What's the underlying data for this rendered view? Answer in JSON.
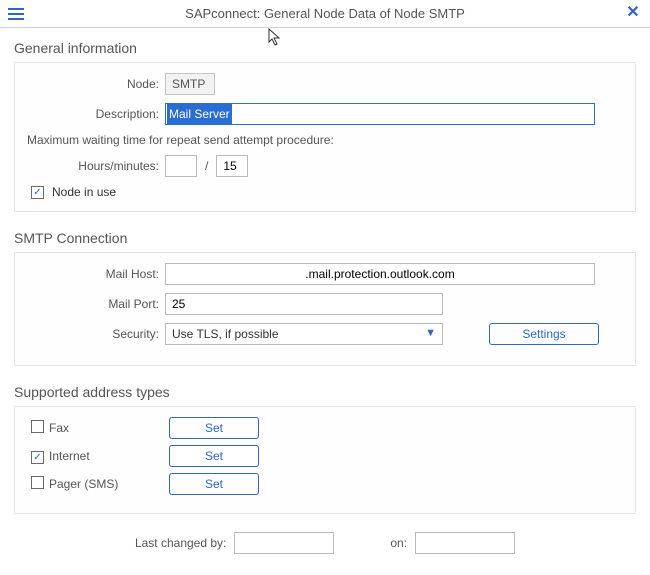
{
  "header": {
    "title": "SAPconnect: General Node Data of Node SMTP"
  },
  "general": {
    "title": "General information",
    "node_label": "Node:",
    "node_value": "SMTP",
    "description_label": "Description:",
    "description_value": "Mail Server",
    "waiting_time_info": "Maximum waiting time for repeat send attempt procedure:",
    "hours_minutes_label": "Hours/minutes:",
    "hours_value": "",
    "minutes_value": "15",
    "node_in_use_label": "Node in use",
    "node_in_use_checked": true
  },
  "smtp": {
    "title": "SMTP Connection",
    "mail_host_label": "Mail Host:",
    "mail_host_value": ".mail.protection.outlook.com",
    "mail_port_label": "Mail Port:",
    "mail_port_value": "25",
    "security_label": "Security:",
    "security_value": "Use TLS, if possible",
    "settings_label": "Settings"
  },
  "addr": {
    "title": "Supported address types",
    "items": [
      {
        "label": "Fax",
        "checked": false,
        "btn": "Set"
      },
      {
        "label": "Internet",
        "checked": true,
        "btn": "Set"
      },
      {
        "label": "Pager (SMS)",
        "checked": false,
        "btn": "Set"
      }
    ]
  },
  "footer": {
    "changed_by_label": "Last changed by:",
    "changed_by_value": "",
    "on_label": "on:",
    "on_value": ""
  }
}
